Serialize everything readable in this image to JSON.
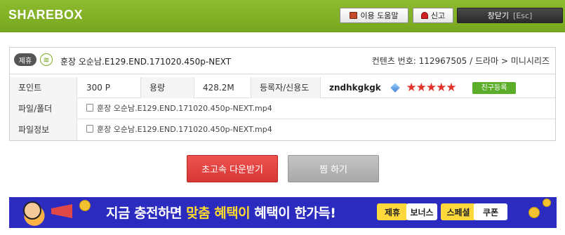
{
  "header": {
    "logo": "SHAREBOX",
    "help_label": "이용 도움말",
    "report_label": "신고",
    "close_label": "창닫기",
    "close_shortcut": "[Esc]"
  },
  "content": {
    "badge": "제휴",
    "file_title": "훈장 오순남.E129.END.171020.450p-NEXT",
    "content_info": "컨텐츠 번호: 112967505 / 드라마 > 미니시리즈",
    "point_label": "포인트",
    "point_value": "300 P",
    "size_label": "용량",
    "size_value": "428.2M",
    "uploader_label": "등록자/신용도",
    "uploader_name": "zndhkgkgk",
    "rating_stars": 5,
    "friend_button": "친구등록",
    "folder_label": "파일/폴더",
    "folder_value": "훈장 오순남.E129.END.171020.450p-NEXT.mp4",
    "fileinfo_label": "파일정보",
    "fileinfo_value": "훈장 오순남.E129.END.171020.450p-NEXT.mp4"
  },
  "actions": {
    "download_label": "초고속 다운받기",
    "bookmark_label": "찜 하기"
  },
  "banner": {
    "text_prefix": "지금 충전하면 ",
    "text_highlight1": "맞춤",
    "text_highlight2": " 혜택이",
    "text_suffix": " 혜택이 한가득!",
    "tags": [
      "제휴",
      "보너스",
      "스페셜",
      "쿠폰"
    ]
  },
  "colors": {
    "header_green": "#8dbb2e",
    "download_red": "#e04442",
    "banner_blue": "#2b2bbf",
    "star_red": "#e0322a"
  }
}
